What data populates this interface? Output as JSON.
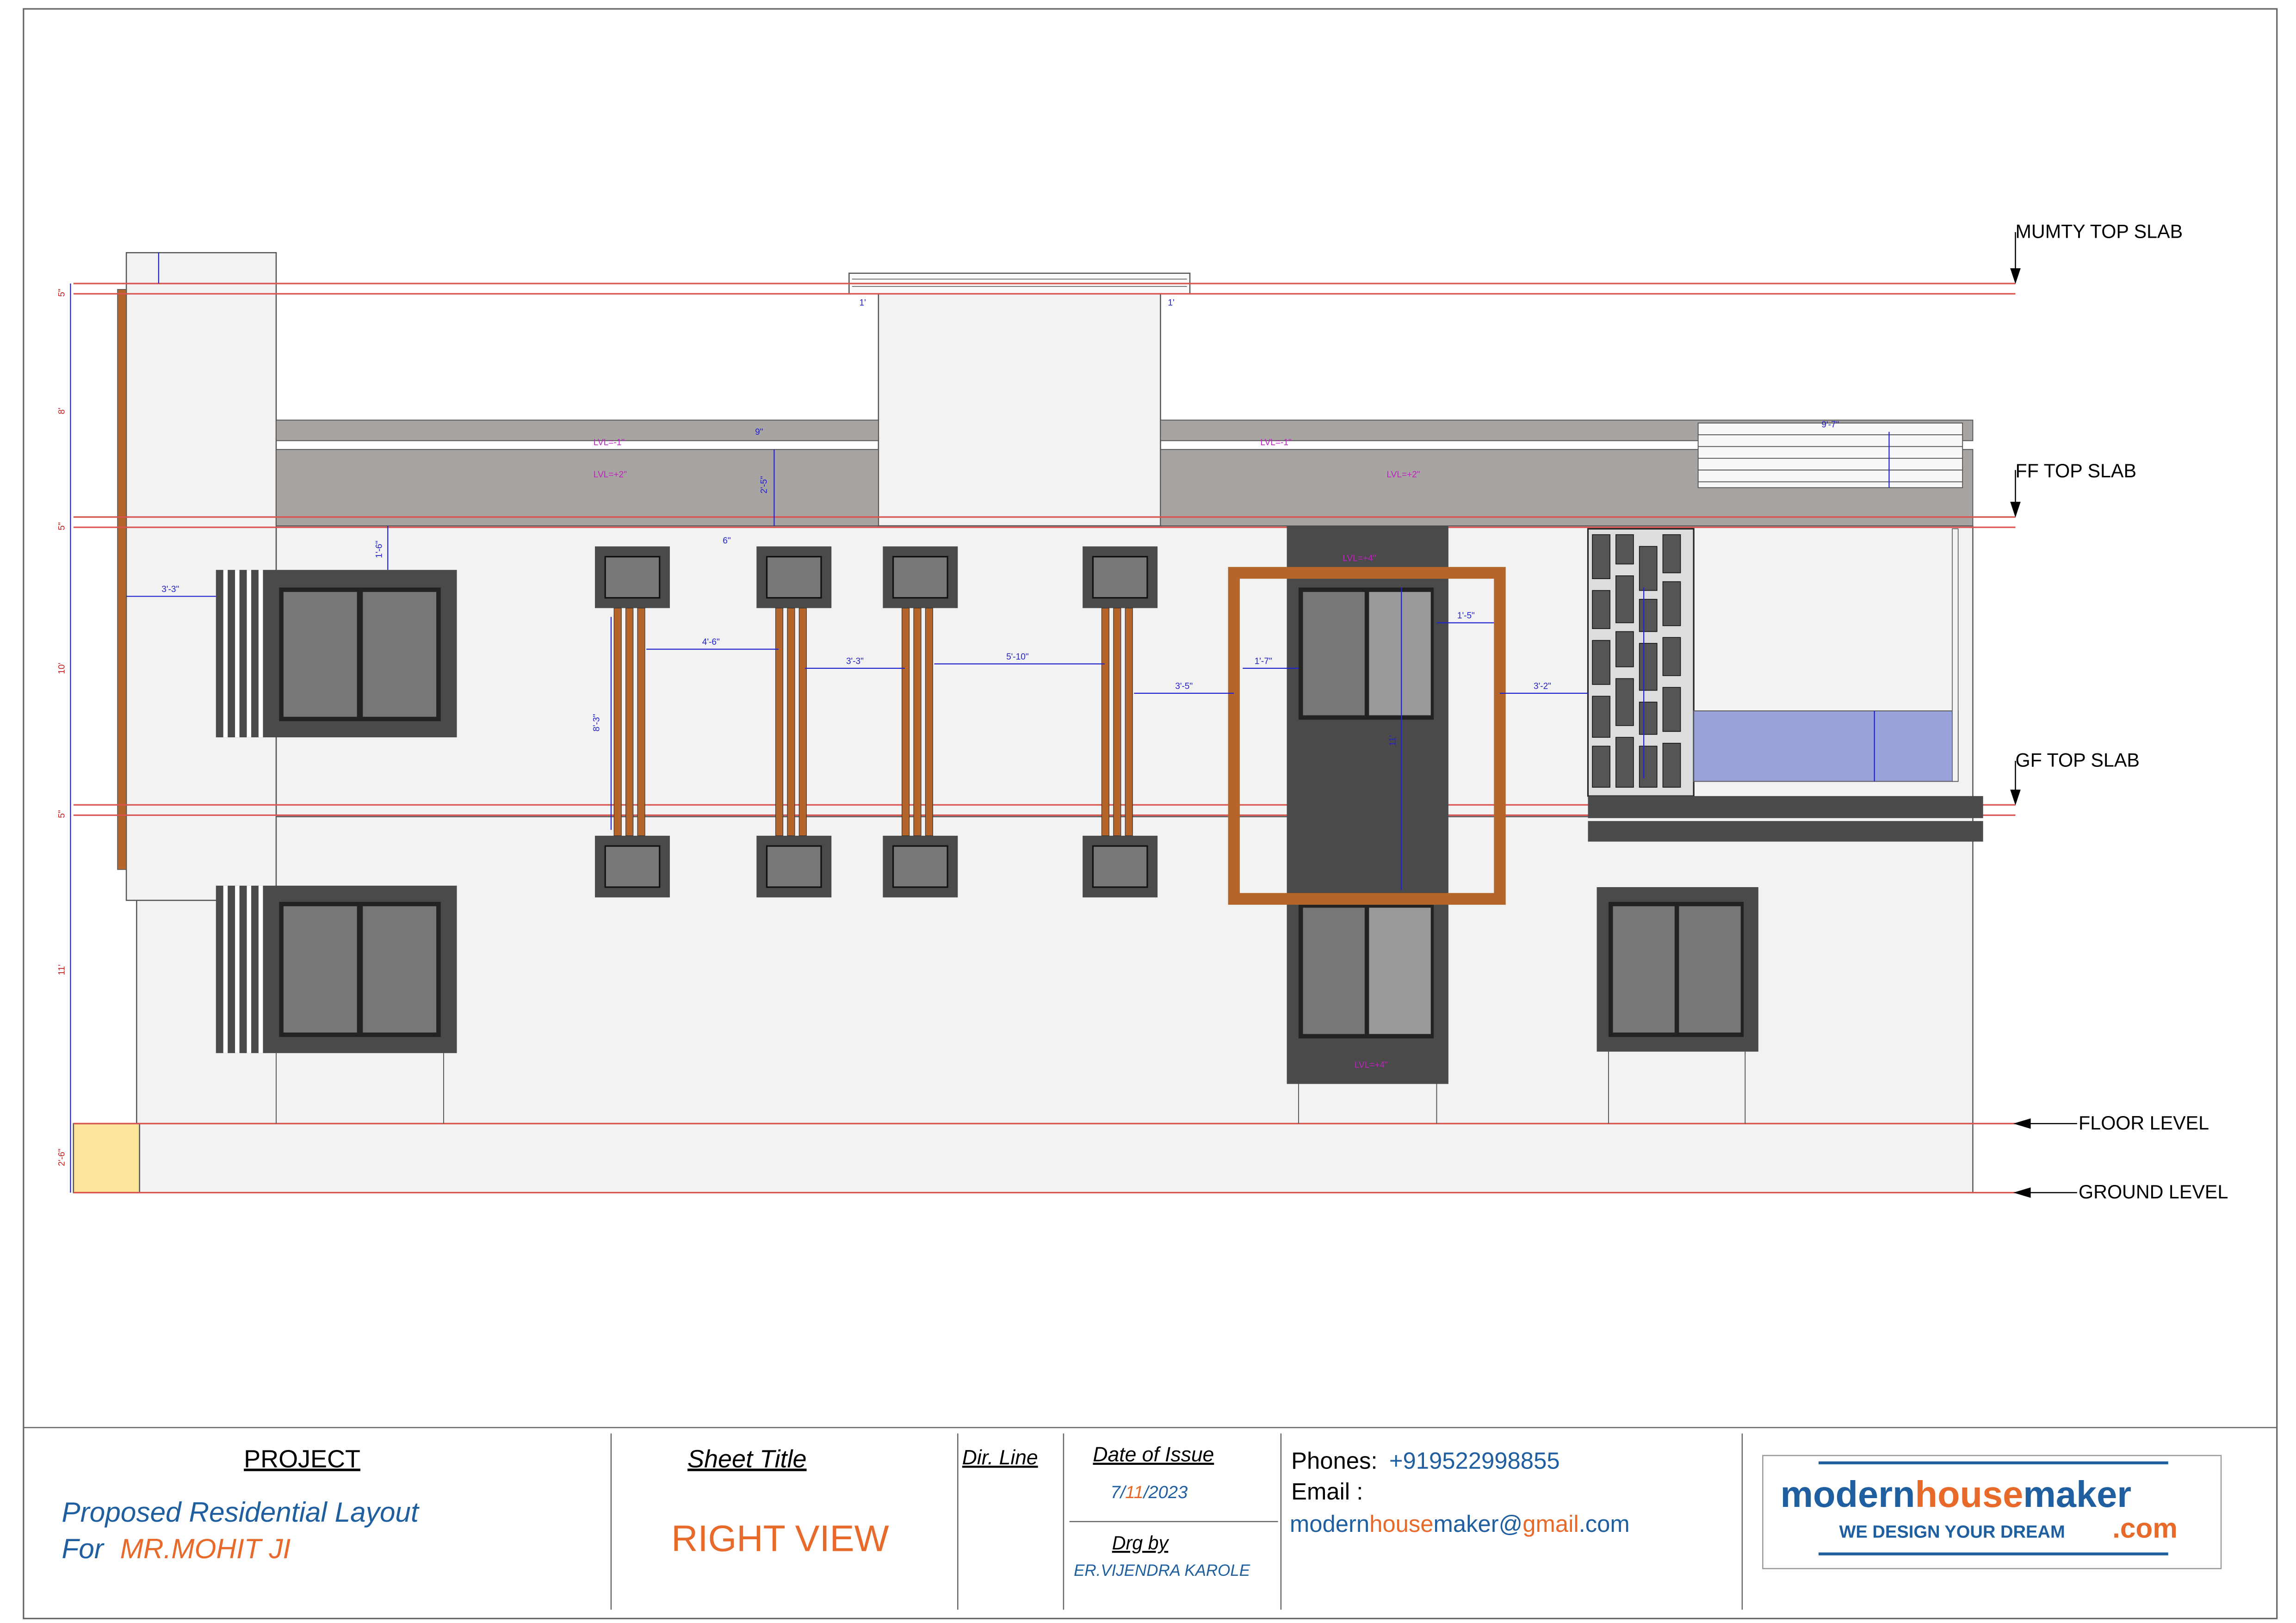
{
  "elevation": {
    "levels": {
      "mumty_top_slab": "MUMTY TOP SLAB",
      "ff_top_slab": "FF TOP SLAB",
      "gf_top_slab": "GF TOP SLAB",
      "floor_level": "FLOOR LEVEL",
      "ground_level": "GROUND LEVEL"
    },
    "left_dims": [
      "5\"",
      "8'",
      "5\"",
      "10'",
      "5\"",
      "11'",
      "2'-6\""
    ],
    "dims": {
      "d_3_3": "3'-3\"",
      "d_4_6": "4'-6\"",
      "d_3_3b": "3'-3\"",
      "d_5_10": "5'-10\"",
      "d_3_5": "3'-5\"",
      "d_1_7": "1'-7\"",
      "d_1_5": "1'-5\"",
      "d_3_2": "3'-2\"",
      "d_11": "11'",
      "d_8_3": "8'-3\"",
      "d_1_6": "1'-6\"",
      "d_2_5": "2'-5\"",
      "d_9_7": "9'-7\"",
      "d_1": "1'",
      "d_1b": "1'",
      "d_6": "6\"",
      "d_9": "9\""
    },
    "lvl_labels": {
      "lvl_m1": "LVL=-1\"",
      "lvl_p2": "LVL=+2\"",
      "lvl_m1b": "LVL=-1\"",
      "lvl_p2b": "LVL=+2\"",
      "lvl_p4": "LVL=+4\"",
      "lvl_p4b": "LVL=+4\""
    }
  },
  "title_block": {
    "project_heading": "PROJECT",
    "project_line1": "Proposed Residential Layout",
    "project_for": "For ",
    "project_client": "MR.MOHIT JI",
    "sheet_title_heading": "Sheet Title",
    "sheet_title": "RIGHT VIEW",
    "dir_line": "Dir. Line",
    "date_heading": "Date of Issue",
    "date_day": "7/",
    "date_month": "11",
    "date_year": "/2023",
    "drg_by_heading": "Drg by",
    "drg_by": "ER.VIJENDRA KAROLE",
    "phones_label": "Phones:",
    "phone": "+919522998855",
    "email_label": "Email :",
    "email_a": "modern",
    "email_b": "house",
    "email_c": "maker@",
    "email_d": "gmail",
    "email_e": ".com",
    "logo_modern": "modern",
    "logo_house": "house",
    "logo_maker": "maker",
    "logo_tagline": "WE DESIGN YOUR DREAM",
    "logo_com": ".com"
  },
  "colors": {
    "wall": "#f2f2f2",
    "slab": "#a8a4a2",
    "frame_dark": "#4a4a4a",
    "wood": "#b5652a",
    "red_line": "#d9534f",
    "dim_blue": "#2222cc",
    "dim_magenta": "#c020c0",
    "glass": "#8f9ad9",
    "plinth_yellow": "#fbe59a",
    "title_blue": "#1f5fa0",
    "title_orange": "#e86a2a"
  }
}
